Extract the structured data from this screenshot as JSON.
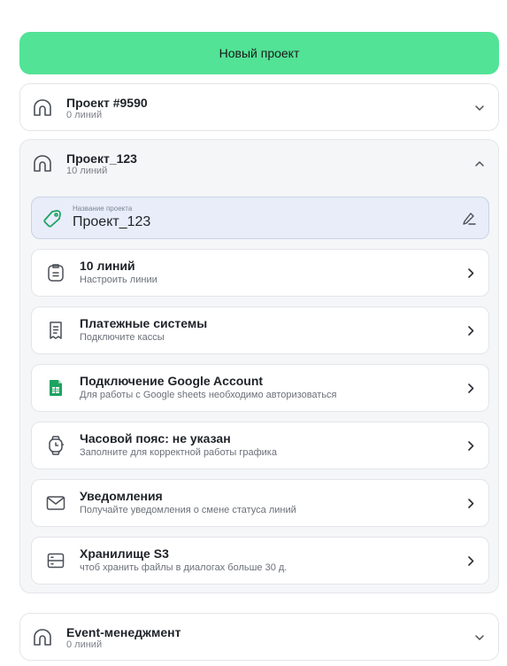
{
  "new_project_button": {
    "label": "Новый проект"
  },
  "projects": [
    {
      "title": "Проект #9590",
      "subtitle": "0 линий",
      "expanded": false
    },
    {
      "title": "Проект_123",
      "subtitle": "10 линий",
      "expanded": true,
      "name_field": {
        "label": "Название проекта",
        "value": "Проект_123"
      },
      "settings": [
        {
          "icon": "clipboard-icon",
          "title": "10 линий",
          "subtitle": "Настроить линии"
        },
        {
          "icon": "receipt-icon",
          "title": "Платежные системы",
          "subtitle": "Подключите кассы"
        },
        {
          "icon": "google-sheets-icon",
          "title": "Подключение Google Account",
          "subtitle": "Для работы с Google sheets необходимо авторизоваться"
        },
        {
          "icon": "watch-icon",
          "title": "Часовой пояс: не указан",
          "subtitle": "Заполните для корректной работы графика"
        },
        {
          "icon": "envelope-icon",
          "title": "Уведомления",
          "subtitle": "Получайте уведомления о смене статуса линий"
        },
        {
          "icon": "storage-icon",
          "title": "Хранилище S3",
          "subtitle": "чтоб хранить файлы в диалогах больше 30 д."
        }
      ]
    },
    {
      "title": "Event-менеджмент",
      "subtitle": "0 линий",
      "expanded": false
    }
  ],
  "colors": {
    "accent": "#52e396",
    "sheets_green": "#1ea362",
    "field_bg": "#e8edf9"
  }
}
